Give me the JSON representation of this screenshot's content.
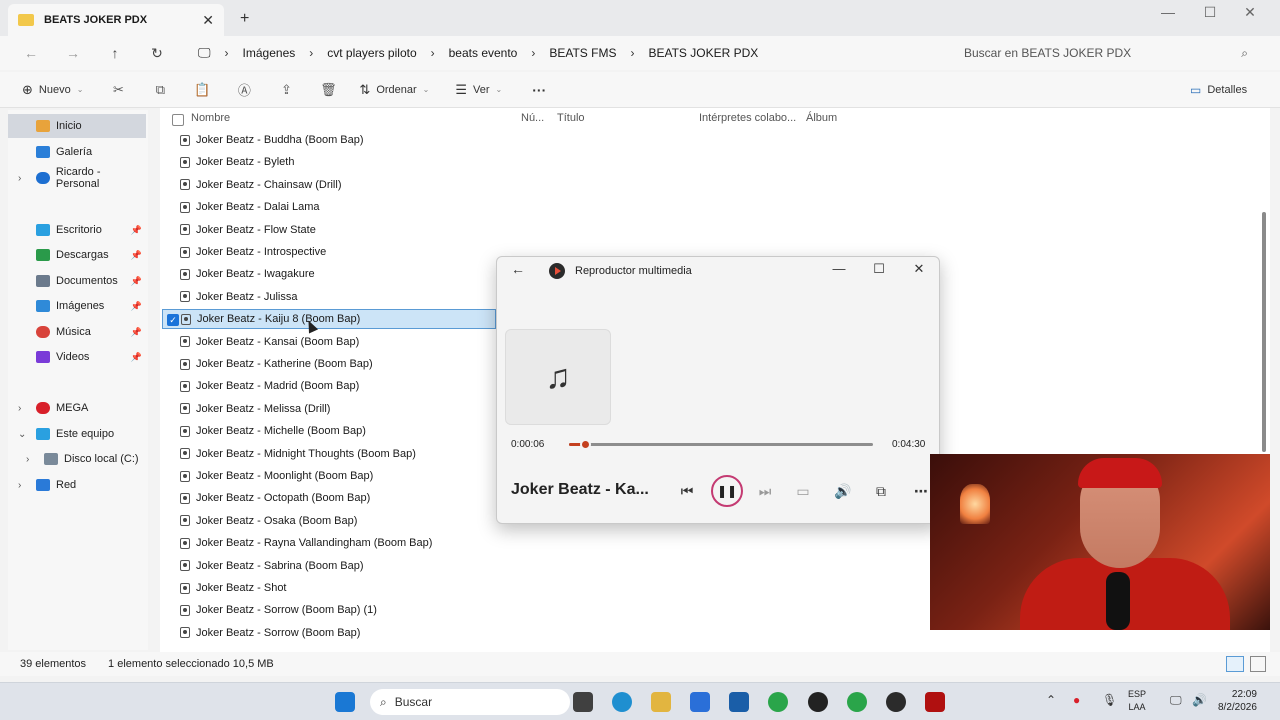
{
  "explorer": {
    "tab_title": "BEATS JOKER PDX",
    "breadcrumb": [
      "Imágenes",
      "cvt players  piloto",
      "beats evento",
      "BEATS FMS",
      "BEATS JOKER PDX"
    ],
    "search_placeholder": "Buscar en BEATS JOKER PDX",
    "toolbar": {
      "new_label": "Nuevo",
      "sort_label": "Ordenar",
      "view_label": "Ver",
      "more_label": "···",
      "details_label": "Detalles"
    },
    "sidebar": {
      "items": [
        {
          "label": "Inicio",
          "icon": "home-icon",
          "color": "#e8a33b"
        },
        {
          "label": "Galería",
          "icon": "gallery-icon",
          "color": "#2b7fd8"
        },
        {
          "label": "Ricardo - Personal",
          "icon": "cloud-icon",
          "color": "#1d6fd1"
        },
        {
          "label": "Escritorio",
          "icon": "desktop-icon",
          "color": "#2aa0e0"
        },
        {
          "label": "Descargas",
          "icon": "download-icon",
          "color": "#2a9a4a"
        },
        {
          "label": "Documentos",
          "icon": "document-icon",
          "color": "#6b7a8c"
        },
        {
          "label": "Imágenes",
          "icon": "pictures-icon",
          "color": "#2f8ad8"
        },
        {
          "label": "Música",
          "icon": "music-icon",
          "color": "#d8433b"
        },
        {
          "label": "Videos",
          "icon": "video-icon",
          "color": "#7a3bd8"
        },
        {
          "label": "MEGA",
          "icon": "mega-icon",
          "color": "#d8202a"
        },
        {
          "label": "Este equipo",
          "icon": "computer-icon",
          "color": "#2aa0e0"
        },
        {
          "label": "Disco local (C:)",
          "icon": "drive-icon",
          "color": "#7a8a9a"
        },
        {
          "label": "Red",
          "icon": "network-icon",
          "color": "#2a7ad8"
        }
      ]
    },
    "columns": [
      "Nombre",
      "Nú...",
      "Título",
      "Intérpretes colabo...",
      "Álbum"
    ],
    "files": [
      "Joker Beatz - Buddha (Boom Bap)",
      "Joker Beatz - Byleth",
      "Joker Beatz - Chainsaw (Drill)",
      "Joker Beatz - Dalai Lama",
      "Joker Beatz - Flow State",
      "Joker Beatz - Introspective",
      "Joker Beatz - Iwagakure",
      "Joker Beatz - Julissa",
      "Joker Beatz - Kaiju 8 (Boom Bap)",
      "Joker Beatz - Kansai (Boom Bap)",
      "Joker Beatz - Katherine (Boom Bap)",
      "Joker Beatz - Madrid (Boom Bap)",
      "Joker Beatz - Melissa (Drill)",
      "Joker Beatz - Michelle (Boom Bap)",
      "Joker Beatz - Midnight Thoughts (Boom Bap)",
      "Joker Beatz - Moonlight (Boom Bap)",
      "Joker Beatz - Octopath (Boom Bap)",
      "Joker Beatz - Osaka (Boom Bap)",
      "Joker Beatz - Rayna Vallandingham (Boom Bap)",
      "Joker Beatz - Sabrina (Boom Bap)",
      "Joker Beatz - Shot",
      "Joker Beatz - Sorrow (Boom Bap) (1)",
      "Joker Beatz - Sorrow (Boom Bap)"
    ],
    "selected_index": 8,
    "status": {
      "count": "39 elementos",
      "selection": "1 elemento seleccionado  10,5 MB"
    }
  },
  "player": {
    "title": "Reproductor multimedia",
    "elapsed": "0:00:06",
    "total": "0:04:30",
    "progress_fraction": 0.022,
    "song_title": "Joker Beatz - Ka...",
    "accent_color": "#c4401f"
  },
  "taskbar": {
    "search_label": "Buscar",
    "lang_top": "ESP",
    "lang_bottom": "LAA",
    "time": "22:09",
    "date": "8/2/2026"
  }
}
